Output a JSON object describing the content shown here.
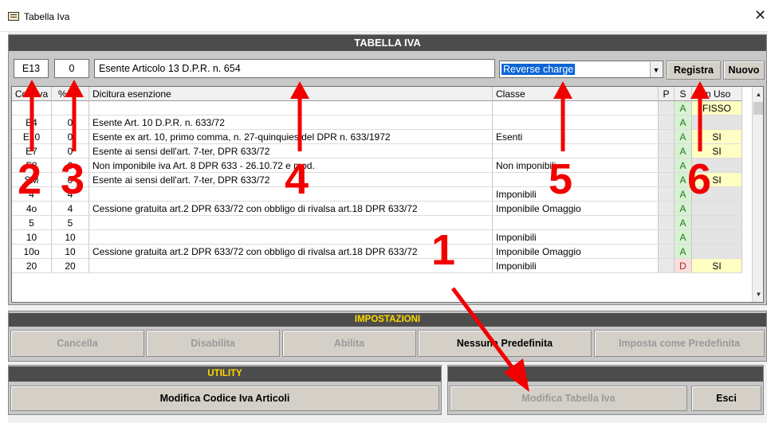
{
  "window": {
    "title": "Tabella Iva",
    "close_glyph": "✕"
  },
  "tabella": {
    "header": "TABELLA IVA",
    "edit": {
      "code": "E13",
      "percent": "0",
      "description": "Esente Articolo 13 D.P.R. n. 654",
      "class_selected": "Reverse charge"
    },
    "buttons": {
      "registra": "Registra",
      "nuovo": "Nuovo"
    },
    "columns": [
      "Cod.Iva",
      "% Iva",
      "Dicitura esenzione",
      "Classe",
      "P",
      "S",
      "In Uso"
    ],
    "rows": [
      {
        "cod": "",
        "pct": "",
        "dic": "",
        "cls": "",
        "s": "A",
        "uso": "FISSO"
      },
      {
        "cod": "E4",
        "pct": "0",
        "dic": "Esente Art. 10 D.P.R. n. 633/72",
        "cls": "",
        "s": "A",
        "uso": ""
      },
      {
        "cod": "E10",
        "pct": "0",
        "dic": "Esente ex art. 10, primo comma, n. 27-quinquies del DPR n. 633/1972",
        "cls": "Esenti",
        "s": "A",
        "uso": "SI"
      },
      {
        "cod": "E7",
        "pct": "0",
        "dic": "Esente ai sensi dell'art. 7-ter, DPR 633/72",
        "cls": "",
        "s": "A",
        "uso": "SI"
      },
      {
        "cod": "F8",
        "pct": "0",
        "dic": "Non imponibile iva Art. 8 DPR 633 - 26.10.72 e mod.",
        "cls": "Non imponibili",
        "s": "A",
        "uso": ""
      },
      {
        "cod": "SM",
        "pct": "0",
        "dic": "Esente ai sensi dell'art. 7-ter, DPR 633/72",
        "cls": "",
        "s": "A",
        "uso": "SI"
      },
      {
        "cod": "4",
        "pct": "4",
        "dic": "",
        "cls": "Imponibili",
        "s": "A",
        "uso": ""
      },
      {
        "cod": "4o",
        "pct": "4",
        "dic": "Cessione gratuita art.2 DPR 633/72 con obbligo di rivalsa art.18 DPR 633/72",
        "cls": "Imponibile Omaggio",
        "s": "A",
        "uso": ""
      },
      {
        "cod": "5",
        "pct": "5",
        "dic": "",
        "cls": "",
        "s": "A",
        "uso": ""
      },
      {
        "cod": "10",
        "pct": "10",
        "dic": "",
        "cls": "Imponibili",
        "s": "A",
        "uso": ""
      },
      {
        "cod": "10o",
        "pct": "10",
        "dic": "Cessione gratuita art.2 DPR 633/72 con obbligo di rivalsa art.18 DPR 633/72",
        "cls": "Imponibile Omaggio",
        "s": "A",
        "uso": ""
      },
      {
        "cod": "20",
        "pct": "20",
        "dic": "",
        "cls": "Imponibili",
        "s": "D",
        "uso": "SI"
      }
    ]
  },
  "impostazioni": {
    "header": "IMPOSTAZIONI",
    "buttons": [
      "Cancella",
      "Disabilita",
      "Abilita",
      "Nessuna Predefinita",
      "Imposta come Predefinita"
    ]
  },
  "utility": {
    "header": "UTILITY",
    "modifica_codice": "Modifica Codice Iva Articoli",
    "modifica_tabella": "Modifica Tabella Iva",
    "esci": "Esci"
  },
  "annotations": {
    "color": "#f20000",
    "labels": [
      "1",
      "2",
      "3",
      "4",
      "5",
      "6"
    ]
  }
}
